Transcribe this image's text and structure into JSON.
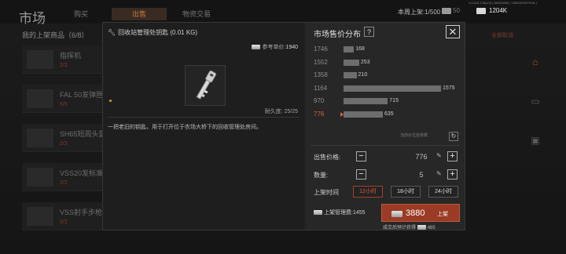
{
  "top": {
    "title": "市场",
    "tabs": [
      "购买",
      "出售",
      "物资交易"
    ],
    "weekly_listing": "本周上架:1/500",
    "version": "1.0.118.178(1/2) | 0820/0830 | 1300/5470/70/18 |",
    "currency1": "50",
    "currency2": "1204K"
  },
  "my_list": {
    "title": "我的上架商品（6/8）",
    "rows": [
      {
        "name": "指挥机",
        "qty": "2/2"
      },
      {
        "name": "FAL 50发弹匣",
        "qty": "5/5"
      },
      {
        "name": "SH65短周头盔",
        "qty": "2/2"
      },
      {
        "name": "VSS20发标准",
        "qty": "2/2"
      },
      {
        "name": "VSS射手步枪",
        "qty": "2/2"
      }
    ],
    "right_tag": "全部取消"
  },
  "modal": {
    "item_name": "回收站管理处钥匙 (0.01 KG)",
    "ref_price_label": "参考单价:",
    "ref_price": "1940",
    "durability": "耐久度: 25/25",
    "description": "一把老旧的钥匙，用于打开位于农场大桥下的回收管理处房间。",
    "dist_title": "市场售价分布",
    "help": "?",
    "close": "✕",
    "current_price_note": "当前价位挂单数",
    "price_label": "出售价格:",
    "price_value": "776",
    "qty_label": "数量:",
    "qty_value": "5",
    "duration_label": "上架时间",
    "durations": [
      "12小时",
      "18小时",
      "24小时"
    ],
    "fee_label": "上架管理费:",
    "fee_value": "1455",
    "list_amount": "3880",
    "list_label": "上架",
    "expected_label": "成交后预计获得",
    "expected_value": "485",
    "minus": "−",
    "plus": "+"
  },
  "chart_data": {
    "type": "bar",
    "categories": [
      "1746",
      "1552",
      "1358",
      "1164",
      "970",
      "776"
    ],
    "values": [
      168,
      253,
      210,
      1575,
      715,
      635
    ],
    "highlight_category": "776",
    "bar_value_labels": [
      "168",
      "253",
      "210",
      "1575",
      "715",
      "635"
    ],
    "xlim": [
      0,
      1575
    ],
    "title": "市场售价分布",
    "colors": {
      "bar": "#6d6d6d",
      "highlight": "#d4663c"
    }
  }
}
